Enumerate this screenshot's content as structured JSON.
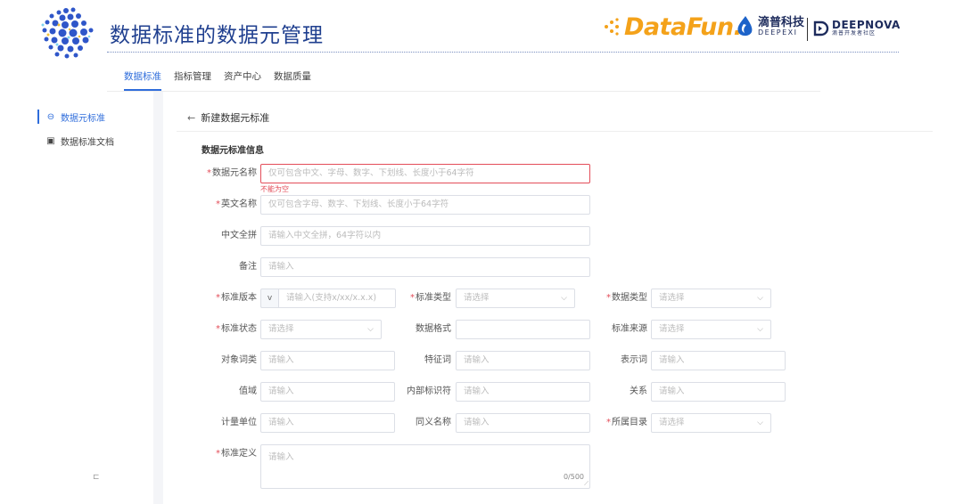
{
  "header": {
    "title": "数据标准的数据元管理",
    "brands": {
      "datafun": "DataFun.",
      "deepexi_cn": "滴普科技",
      "deepexi_en": "DEEPEXI",
      "deepnova_en": "DEEPNOVA",
      "deepnova_cn": "滴普开发者社区"
    },
    "accent_color": "#2f6ddb",
    "title_color": "#1f3f8f"
  },
  "top_nav": {
    "tabs": [
      {
        "label": "数据标准",
        "active": true
      },
      {
        "label": "指标管理",
        "active": false
      },
      {
        "label": "资产中心",
        "active": false
      },
      {
        "label": "数据质量",
        "active": false
      }
    ]
  },
  "sidebar": {
    "items": [
      {
        "label": "数据元标准",
        "icon": "circle-minus-icon",
        "active": true
      },
      {
        "label": "数据标准文档",
        "icon": "document-icon",
        "active": false
      }
    ],
    "collapse_icon": "collapse-icon"
  },
  "page": {
    "back_label": "新建数据元标准",
    "section_title": "数据元标准信息"
  },
  "form": {
    "element_name": {
      "label": "数据元名称",
      "required": true,
      "placeholder": "仅可包含中文、字母、数字、下划线、长度小于64字符",
      "error": "不能为空"
    },
    "english_name": {
      "label": "英文名称",
      "required": true,
      "placeholder": "仅可包含字母、数字、下划线、长度小于64字符"
    },
    "pinyin": {
      "label": "中文全拼",
      "required": false,
      "placeholder": "请输入中文全拼，64字符以内"
    },
    "remark": {
      "label": "备注",
      "required": false,
      "placeholder": "请输入"
    },
    "version": {
      "label": "标准版本",
      "required": true,
      "prefix": "v",
      "placeholder": "请输入(支持x/xx/x.x.x)"
    },
    "std_type": {
      "label": "标准类型",
      "required": true,
      "placeholder": "请选择"
    },
    "data_type": {
      "label": "数据类型",
      "required": true,
      "placeholder": "请选择"
    },
    "std_status": {
      "label": "标准状态",
      "required": true,
      "placeholder": "请选择"
    },
    "data_format": {
      "label": "数据格式",
      "required": false,
      "placeholder": ""
    },
    "std_source": {
      "label": "标准来源",
      "required": false,
      "placeholder": "请选择"
    },
    "object_class": {
      "label": "对象词类",
      "required": false,
      "placeholder": "请输入"
    },
    "feature_word": {
      "label": "特征词",
      "required": false,
      "placeholder": "请输入"
    },
    "represent_word": {
      "label": "表示词",
      "required": false,
      "placeholder": "请输入"
    },
    "value_domain": {
      "label": "值域",
      "required": false,
      "placeholder": "请输入"
    },
    "internal_id": {
      "label": "内部标识符",
      "required": false,
      "placeholder": "请输入"
    },
    "relation": {
      "label": "关系",
      "required": false,
      "placeholder": "请输入"
    },
    "unit": {
      "label": "计量单位",
      "required": false,
      "placeholder": "请输入"
    },
    "synonym": {
      "label": "同义名称",
      "required": false,
      "placeholder": "请输入"
    },
    "catalog": {
      "label": "所属目录",
      "required": true,
      "placeholder": "请选择"
    },
    "definition": {
      "label": "标准定义",
      "required": true,
      "placeholder": "请输入",
      "counter": "0/500"
    }
  }
}
